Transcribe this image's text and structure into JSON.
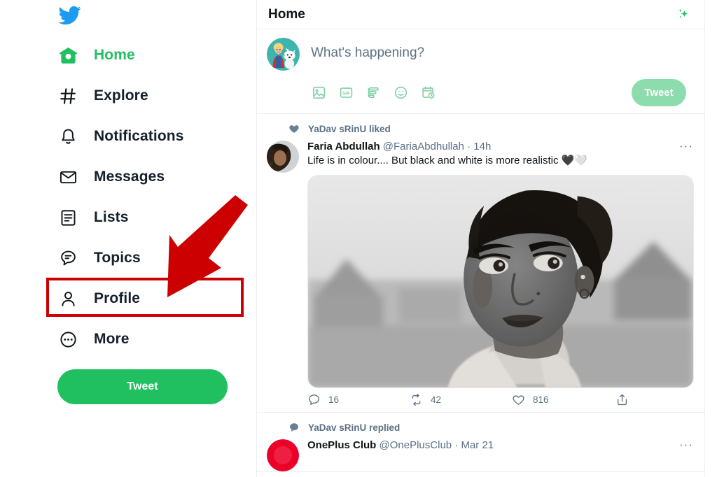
{
  "colors": {
    "accent_green": "#20bf60",
    "accent_green_light": "#8ddcae",
    "twitter_blue": "#1d9bf0",
    "text_primary": "#0f1419",
    "text_secondary": "#5b7083",
    "annotation_red": "#cc0000",
    "border": "#eceef0"
  },
  "sidebar": {
    "logo": "twitter-bird-logo",
    "items": [
      {
        "label": "Home",
        "icon": "home-icon",
        "active": true
      },
      {
        "label": "Explore",
        "icon": "hashtag-icon",
        "active": false
      },
      {
        "label": "Notifications",
        "icon": "bell-icon",
        "active": false
      },
      {
        "label": "Messages",
        "icon": "envelope-icon",
        "active": false
      },
      {
        "label": "Lists",
        "icon": "list-icon",
        "active": false
      },
      {
        "label": "Topics",
        "icon": "topics-chat-icon",
        "active": false
      },
      {
        "label": "Profile",
        "icon": "person-icon",
        "active": false
      },
      {
        "label": "More",
        "icon": "ellipsis-circle-icon",
        "active": false
      }
    ],
    "tweet_button": "Tweet"
  },
  "header": {
    "title": "Home",
    "sparkle_icon": "sparkle-icon"
  },
  "compose": {
    "avatar": "user-avatar-cartoon",
    "placeholder": "What's happening?",
    "tools": [
      {
        "name": "media-icon",
        "label": "Media"
      },
      {
        "name": "gif-icon",
        "label": "GIF"
      },
      {
        "name": "poll-icon",
        "label": "Poll"
      },
      {
        "name": "emoji-icon",
        "label": "Emoji"
      },
      {
        "name": "schedule-icon",
        "label": "Schedule"
      }
    ],
    "tweet_button": "Tweet"
  },
  "timeline": [
    {
      "context_icon": "heart-filled-icon",
      "context_text": "YaDav sRinU liked",
      "author_name": "Faria Abdullah",
      "handle": "@FariaAbdhullah",
      "separator": "·",
      "timestamp": "14h",
      "more": "···",
      "text": "Life is in colour.... But black and white is more realistic 🖤🤍",
      "media": "black-and-white-portrait-photo",
      "actions": {
        "reply_count": "16",
        "retweet_count": "42",
        "like_count": "816",
        "share": ""
      }
    },
    {
      "context_icon": "reply-filled-icon",
      "context_text": "YaDav sRinU replied",
      "author_name": "OnePlus Club",
      "handle": "@OnePlusClub",
      "separator": "·",
      "timestamp": "Mar 21",
      "more": "···"
    }
  ],
  "annotation": {
    "highlight_target": "Profile",
    "box_color": "#cc0000",
    "arrow": "down-left-arrow"
  }
}
